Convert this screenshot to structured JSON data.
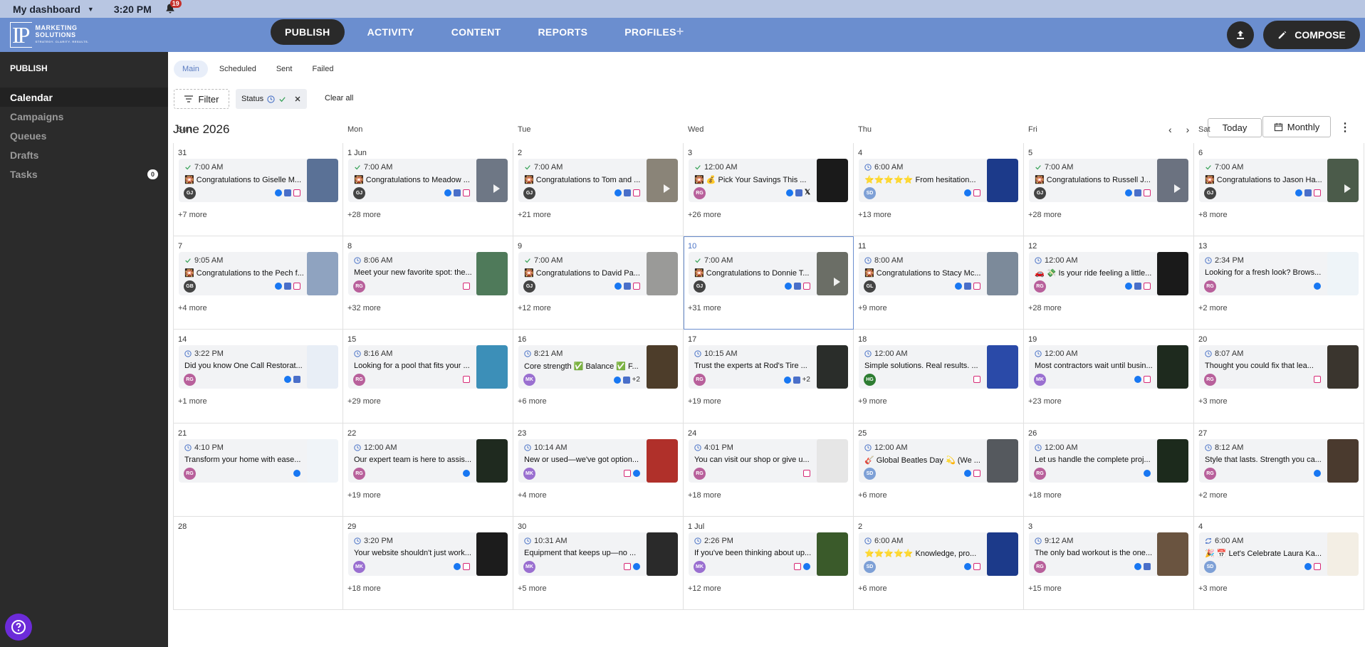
{
  "topbar": {
    "dashboard": "My dashboard",
    "time": "3:20 PM",
    "notifications": "19"
  },
  "brand": {
    "logo_letters": "IP",
    "line1": "MARKETING",
    "line2": "SOLUTIONS",
    "tagline": "STRATEGY. CLARITY. RESULTS."
  },
  "nav": {
    "publish": "PUBLISH",
    "activity": "ACTIVITY",
    "content": "CONTENT",
    "reports": "REPORTS",
    "profiles": "PROFILES",
    "profiles_plus": "+",
    "compose": "COMPOSE"
  },
  "sidebar": {
    "heading": "PUBLISH",
    "items": [
      {
        "label": "Calendar"
      },
      {
        "label": "Campaigns"
      },
      {
        "label": "Queues"
      },
      {
        "label": "Drafts"
      },
      {
        "label": "Tasks",
        "badge": "0"
      }
    ]
  },
  "tabs": [
    "Main",
    "Scheduled",
    "Sent",
    "Failed"
  ],
  "filter": {
    "label": "Filter",
    "status_label": "Status",
    "clear_all": "Clear all"
  },
  "calendar": {
    "month": "June 2026",
    "today": "Today",
    "view": "Monthly",
    "weekdays": [
      "Sun",
      "Mon",
      "Tue",
      "Wed",
      "Thu",
      "Fri",
      "Sat"
    ],
    "days": [
      {
        "d": "31",
        "time": "7:00 AM",
        "s": "ok",
        "text": "🎇 Congratulations to Giselle M...",
        "av": "GJ",
        "avc": "#444",
        "nets": [
          "fb",
          "gb",
          "ig"
        ],
        "thumb": "#5a7196",
        "play": false,
        "more": "+7 more"
      },
      {
        "d": "1 Jun",
        "time": "7:00 AM",
        "s": "ok",
        "text": "🎇 Congratulations to Meadow ...",
        "av": "GJ",
        "avc": "#444",
        "nets": [
          "fb",
          "gb",
          "ig"
        ],
        "thumb": "#6e7785",
        "play": true,
        "more": "+28 more"
      },
      {
        "d": "2",
        "time": "7:00 AM",
        "s": "ok",
        "text": "🎇 Congratulations to Tom and ...",
        "av": "GJ",
        "avc": "#444",
        "nets": [
          "fb",
          "gb",
          "ig"
        ],
        "thumb": "#8a8478",
        "play": true,
        "more": "+21 more"
      },
      {
        "d": "3",
        "time": "12:00 AM",
        "s": "ok",
        "text": "🎇 💰 Pick Your Savings This ...",
        "av": "RG",
        "avc": "#b8609b",
        "nets": [
          "fb",
          "gb",
          "x"
        ],
        "thumb": "#1a1a1a",
        "play": false,
        "more": "+26 more"
      },
      {
        "d": "4",
        "time": "6:00 AM",
        "s": "clock",
        "text": "⭐⭐⭐⭐⭐ From hesitation...",
        "av": "SD",
        "avc": "#7ea0d6",
        "nets": [
          "fb",
          "ig"
        ],
        "thumb": "#1c3a8a",
        "play": false,
        "more": "+13 more"
      },
      {
        "d": "5",
        "time": "7:00 AM",
        "s": "ok",
        "text": "🎇 Congratulations to Russell J...",
        "av": "GJ",
        "avc": "#444",
        "nets": [
          "fb",
          "gb",
          "ig"
        ],
        "thumb": "#6b7280",
        "play": true,
        "more": "+28 more"
      },
      {
        "d": "6",
        "time": "7:00 AM",
        "s": "ok",
        "text": "🎇 Congratulations to Jason Ha...",
        "av": "GJ",
        "avc": "#444",
        "nets": [
          "fb",
          "gb",
          "ig"
        ],
        "thumb": "#4b5b4a",
        "play": true,
        "more": "+8 more"
      },
      {
        "d": "7",
        "time": "9:05 AM",
        "s": "ok",
        "text": "🎇 Congratulations to the Pech f...",
        "av": "GB",
        "avc": "#444",
        "nets": [
          "fb",
          "gb",
          "ig"
        ],
        "thumb": "#8fa3c0",
        "play": false,
        "more": "+4 more"
      },
      {
        "d": "8",
        "time": "8:06 AM",
        "s": "clock",
        "text": "Meet your new favorite spot: the...",
        "av": "RG",
        "avc": "#b8609b",
        "nets": [
          "ig"
        ],
        "thumb": "#4f7a5a",
        "play": false,
        "more": "+32 more"
      },
      {
        "d": "9",
        "time": "7:00 AM",
        "s": "ok",
        "text": "🎇 Congratulations to David Pa...",
        "av": "GJ",
        "avc": "#444",
        "nets": [
          "fb",
          "gb",
          "ig"
        ],
        "thumb": "#9a9a98",
        "play": false,
        "more": "+12 more"
      },
      {
        "d": "10",
        "time": "7:00 AM",
        "s": "ok",
        "text": "🎇 Congratulations to Donnie T...",
        "av": "GJ",
        "avc": "#444",
        "nets": [
          "fb",
          "gb",
          "ig"
        ],
        "thumb": "#6b6e66",
        "play": true,
        "more": "+31 more",
        "sel": true
      },
      {
        "d": "11",
        "time": "8:00 AM",
        "s": "clock",
        "text": "🎇 Congratulations to Stacy Mc...",
        "av": "GL",
        "avc": "#444",
        "nets": [
          "fb",
          "gb",
          "ig"
        ],
        "thumb": "#7c8a9a",
        "play": false,
        "more": "+9 more"
      },
      {
        "d": "12",
        "time": "12:00 AM",
        "s": "clock",
        "text": "🚗 💸 Is your ride feeling a little...",
        "av": "RG",
        "avc": "#b8609b",
        "nets": [
          "fb",
          "gb",
          "ig"
        ],
        "thumb": "#1a1a1a",
        "play": false,
        "more": "+28 more"
      },
      {
        "d": "13",
        "time": "2:34 PM",
        "s": "clock",
        "text": "Looking for a fresh look? Brows...",
        "av": "RG",
        "avc": "#b8609b",
        "nets": [
          "fb"
        ],
        "thumb": "#eef4f8",
        "play": false,
        "more": "+2 more"
      },
      {
        "d": "14",
        "time": "3:22 PM",
        "s": "clock",
        "text": "Did you know One Call Restorat...",
        "av": "RG",
        "avc": "#b8609b",
        "nets": [
          "fb",
          "gb"
        ],
        "thumb": "#e8eef6",
        "play": false,
        "more": "+1 more"
      },
      {
        "d": "15",
        "time": "8:16 AM",
        "s": "clock",
        "text": "Looking for a pool that fits your ...",
        "av": "RG",
        "avc": "#b8609b",
        "nets": [
          "ig"
        ],
        "thumb": "#3c8fb8",
        "play": false,
        "more": "+29 more"
      },
      {
        "d": "16",
        "time": "8:21 AM",
        "s": "clock",
        "text": "Core strength ✅ Balance ✅ F...",
        "av": "MK",
        "avc": "#9a6fd0",
        "nets": [
          "fb",
          "gb",
          "+2"
        ],
        "thumb": "#4d3d2a",
        "play": false,
        "more": "+6 more"
      },
      {
        "d": "17",
        "time": "10:15 AM",
        "s": "clock",
        "text": "Trust the experts at Rod's Tire ...",
        "av": "RG",
        "avc": "#b8609b",
        "nets": [
          "fb",
          "gb",
          "+2"
        ],
        "thumb": "#2a2d2a",
        "play": false,
        "more": "+19 more"
      },
      {
        "d": "18",
        "time": "12:00 AM",
        "s": "clock",
        "text": "Simple solutions. Real results. ...",
        "av": "HG",
        "avc": "#2e7d32",
        "nets": [
          "ig"
        ],
        "thumb": "#2a4aa8",
        "play": false,
        "more": "+9 more"
      },
      {
        "d": "19",
        "time": "12:00 AM",
        "s": "clock",
        "text": "Most contractors wait until busin...",
        "av": "MK",
        "avc": "#9a6fd0",
        "nets": [
          "fb",
          "ig"
        ],
        "thumb": "#1e2a1e",
        "play": false,
        "more": "+23 more"
      },
      {
        "d": "20",
        "time": "8:07 AM",
        "s": "clock",
        "text": "Thought you could fix that lea...",
        "av": "RG",
        "avc": "#b8609b",
        "nets": [
          "ig"
        ],
        "thumb": "#3a352e",
        "play": false,
        "more": "+3 more"
      },
      {
        "d": "21",
        "time": "4:10 PM",
        "s": "clock",
        "text": "Transform your home with ease...",
        "av": "RG",
        "avc": "#b8609b",
        "nets": [
          "fb"
        ],
        "thumb": "#f0f4f8",
        "play": false,
        "more": ""
      },
      {
        "d": "22",
        "time": "12:00 AM",
        "s": "clock",
        "text": "Our expert team is here to assis...",
        "av": "RG",
        "avc": "#b8609b",
        "nets": [
          "fb"
        ],
        "thumb": "#1f2a1f",
        "play": false,
        "more": "+19 more"
      },
      {
        "d": "23",
        "time": "10:14 AM",
        "s": "clock",
        "text": "New or used—we've got option...",
        "av": "MK",
        "avc": "#9a6fd0",
        "nets": [
          "ig",
          "fb"
        ],
        "thumb": "#b0302a",
        "play": false,
        "more": "+4 more"
      },
      {
        "d": "24",
        "time": "4:01 PM",
        "s": "clock",
        "text": "You can visit our shop or give u...",
        "av": "RG",
        "avc": "#b8609b",
        "nets": [
          "ig"
        ],
        "thumb": "#e6e6e6",
        "play": false,
        "more": "+18 more"
      },
      {
        "d": "25",
        "time": "12:00 AM",
        "s": "clock",
        "text": "🎸 Global Beatles Day 💫 (We ...",
        "av": "SD",
        "avc": "#7ea0d6",
        "nets": [
          "fb",
          "ig"
        ],
        "thumb": "#55595e",
        "play": false,
        "more": "+6 more"
      },
      {
        "d": "26",
        "time": "12:00 AM",
        "s": "clock",
        "text": "Let us handle the complete proj...",
        "av": "RG",
        "avc": "#b8609b",
        "nets": [
          "fb"
        ],
        "thumb": "#1c2a1c",
        "play": false,
        "more": "+18 more"
      },
      {
        "d": "27",
        "time": "8:12 AM",
        "s": "clock",
        "text": "Style that lasts. Strength you ca...",
        "av": "RG",
        "avc": "#b8609b",
        "nets": [
          "fb"
        ],
        "thumb": "#4a3a2e",
        "play": false,
        "more": "+2 more"
      },
      {
        "d": "28",
        "empty": true
      },
      {
        "d": "29",
        "time": "3:20 PM",
        "s": "clock",
        "text": "Your website shouldn't just work...",
        "av": "MK",
        "avc": "#9a6fd0",
        "nets": [
          "fb",
          "ig"
        ],
        "thumb": "#1c1c1c",
        "play": false,
        "more": "+18 more"
      },
      {
        "d": "30",
        "time": "10:31 AM",
        "s": "clock",
        "text": "Equipment that keeps up—no ...",
        "av": "MK",
        "avc": "#9a6fd0",
        "nets": [
          "ig",
          "fb"
        ],
        "thumb": "#2a2a2a",
        "play": false,
        "more": "+5 more"
      },
      {
        "d": "1 Jul",
        "time": "2:26 PM",
        "s": "clock",
        "text": "If you've been thinking about up...",
        "av": "MK",
        "avc": "#9a6fd0",
        "nets": [
          "ig",
          "fb"
        ],
        "thumb": "#3a5a2a",
        "play": false,
        "more": "+12 more"
      },
      {
        "d": "2",
        "time": "6:00 AM",
        "s": "clock",
        "text": "⭐⭐⭐⭐⭐ Knowledge, pro...",
        "av": "SD",
        "avc": "#7ea0d6",
        "nets": [
          "fb",
          "ig"
        ],
        "thumb": "#1c3a8a",
        "play": false,
        "more": "+6 more"
      },
      {
        "d": "3",
        "time": "9:12 AM",
        "s": "clock",
        "text": "The only bad workout is the one...",
        "av": "RG",
        "avc": "#b8609b",
        "nets": [
          "fb",
          "gb"
        ],
        "thumb": "#6a5440",
        "play": false,
        "more": "+15 more"
      },
      {
        "d": "4",
        "time": "6:00 AM",
        "s": "repeat",
        "text": "🎉 📅 Let's Celebrate Laura Ka...",
        "av": "SD",
        "avc": "#7ea0d6",
        "nets": [
          "fb",
          "ig"
        ],
        "thumb": "#f3eee4",
        "play": false,
        "more": "+3 more"
      }
    ]
  }
}
